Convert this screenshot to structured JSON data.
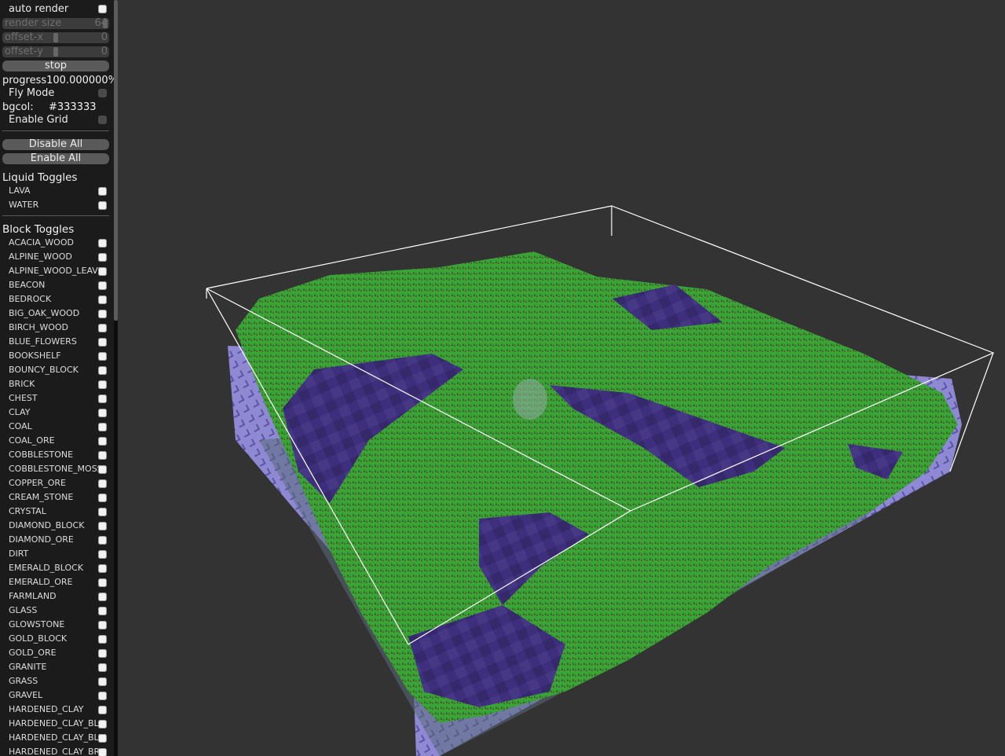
{
  "top": {
    "auto_render": {
      "label": "auto render",
      "checked": true
    },
    "render_size": {
      "label": "render size",
      "value": "64"
    },
    "offset_x": {
      "label": "offset-x",
      "value": "0"
    },
    "offset_y": {
      "label": "offset-y",
      "value": "0"
    },
    "stop_label": "stop",
    "progress": {
      "label": "progress",
      "value": "100.000000%"
    },
    "fly_mode": {
      "label": "Fly Mode",
      "checked": false
    },
    "bgcol": {
      "label": "bgcol:",
      "value": "#333333"
    },
    "enable_grid": {
      "label": "Enable Grid",
      "checked": false
    },
    "disable_all_label": "Disable All",
    "enable_all_label": "Enable All"
  },
  "liquid": {
    "title": "Liquid Toggles",
    "items": [
      {
        "label": "LAVA",
        "checked": true
      },
      {
        "label": "WATER",
        "checked": true
      }
    ]
  },
  "blocks": {
    "title": "Block Toggles",
    "items": [
      {
        "label": "ACACIA_WOOD",
        "checked": true
      },
      {
        "label": "ALPINE_WOOD",
        "checked": true
      },
      {
        "label": "ALPINE_WOOD_LEAVES",
        "checked": true
      },
      {
        "label": "BEACON",
        "checked": true
      },
      {
        "label": "BEDROCK",
        "checked": true
      },
      {
        "label": "BIG_OAK_WOOD",
        "checked": true
      },
      {
        "label": "BIRCH_WOOD",
        "checked": true
      },
      {
        "label": "BLUE_FLOWERS",
        "checked": true
      },
      {
        "label": "BOOKSHELF",
        "checked": true
      },
      {
        "label": "BOUNCY_BLOCK",
        "checked": true
      },
      {
        "label": "BRICK",
        "checked": true
      },
      {
        "label": "CHEST",
        "checked": true
      },
      {
        "label": "CLAY",
        "checked": true
      },
      {
        "label": "COAL",
        "checked": true
      },
      {
        "label": "COAL_ORE",
        "checked": true
      },
      {
        "label": "COBBLESTONE",
        "checked": true
      },
      {
        "label": "COBBLESTONE_MOSSY",
        "checked": true
      },
      {
        "label": "COPPER_ORE",
        "checked": true
      },
      {
        "label": "CREAM_STONE",
        "checked": true
      },
      {
        "label": "CRYSTAL",
        "checked": true
      },
      {
        "label": "DIAMOND_BLOCK",
        "checked": true
      },
      {
        "label": "DIAMOND_ORE",
        "checked": true
      },
      {
        "label": "DIRT",
        "checked": true
      },
      {
        "label": "EMERALD_BLOCK",
        "checked": true
      },
      {
        "label": "EMERALD_ORE",
        "checked": true
      },
      {
        "label": "FARMLAND",
        "checked": true
      },
      {
        "label": "GLASS",
        "checked": true
      },
      {
        "label": "GLOWSTONE",
        "checked": true
      },
      {
        "label": "GOLD_BLOCK",
        "checked": true
      },
      {
        "label": "GOLD_ORE",
        "checked": true
      },
      {
        "label": "GRANITE",
        "checked": true
      },
      {
        "label": "GRASS",
        "checked": true
      },
      {
        "label": "GRAVEL",
        "checked": true
      },
      {
        "label": "HARDENED_CLAY",
        "checked": true
      },
      {
        "label": "HARDENED_CLAY_BLACK",
        "checked": true
      },
      {
        "label": "HARDENED_CLAY_BLUE",
        "checked": true
      },
      {
        "label": "HARDENED_CLAY_BROWN",
        "checked": true
      }
    ]
  },
  "colors": {
    "background": "#333333",
    "terrain_green": "#3fa83a",
    "water_purple": "#3c2f78",
    "bounding_box": "#ffffff"
  }
}
